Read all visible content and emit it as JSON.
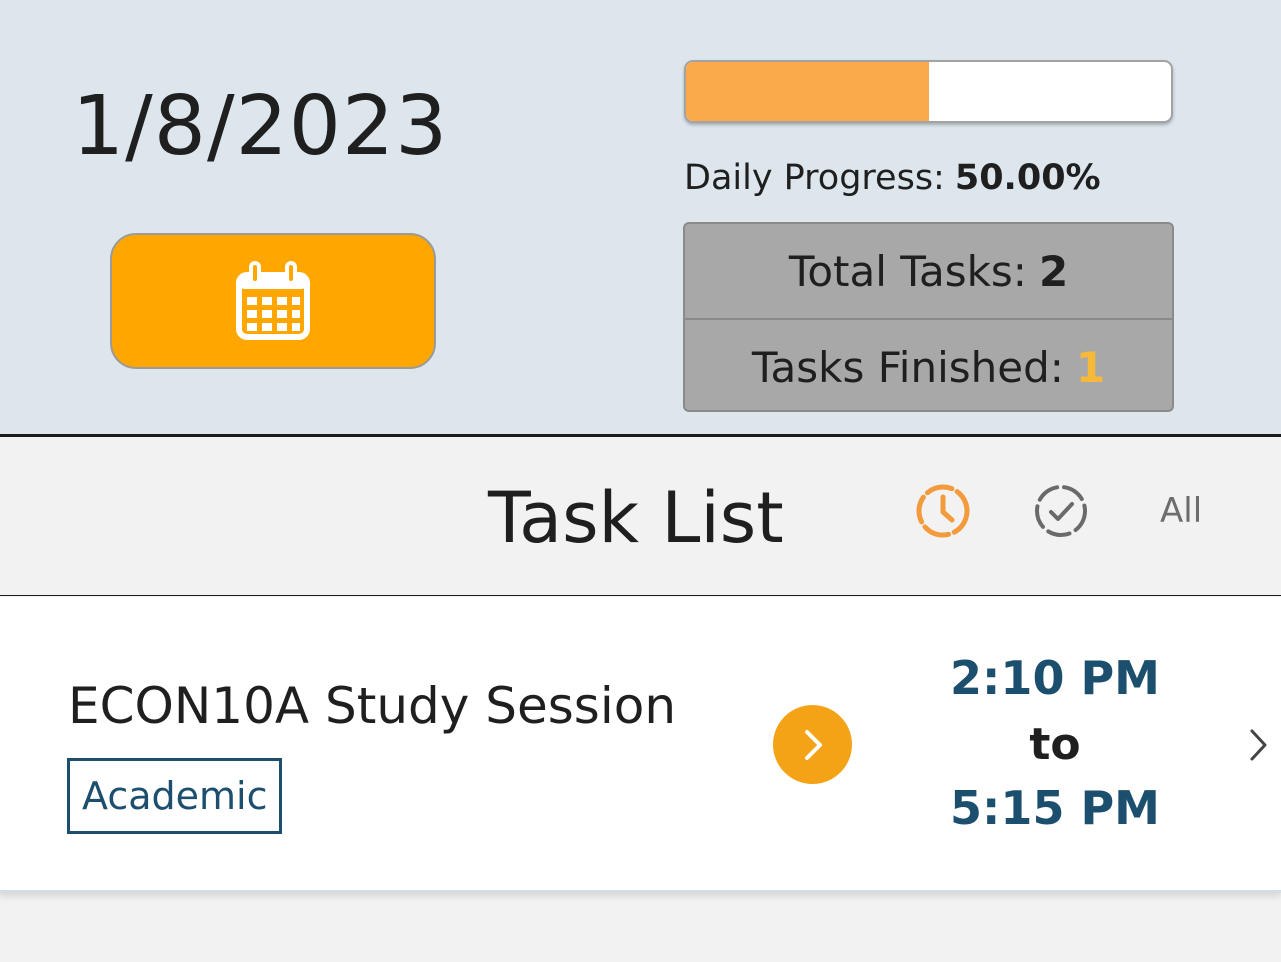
{
  "header": {
    "date": "1/8/2023",
    "calendar_button_icon": "calendar-icon",
    "progress": {
      "fraction": 0.5,
      "label": "Daily Progress:",
      "value": "50.00%",
      "fill_color": "#fbaa4b"
    },
    "stats": {
      "total_label": "Total Tasks:",
      "total_value": "2",
      "finished_label": "Tasks Finished:",
      "finished_value": "1"
    },
    "accent_color": "#ffa600"
  },
  "task_list": {
    "title": "Task List",
    "filters": {
      "pending_icon": "clock-icon",
      "done_icon": "check-circle-icon",
      "all_label": "All"
    }
  },
  "tasks": [
    {
      "title": "ECON10A Study Session",
      "tag": "Academic",
      "start": "2:10 PM",
      "separator": "to",
      "end": "5:15 PM",
      "action_icon": "chevron-right-icon"
    }
  ]
}
